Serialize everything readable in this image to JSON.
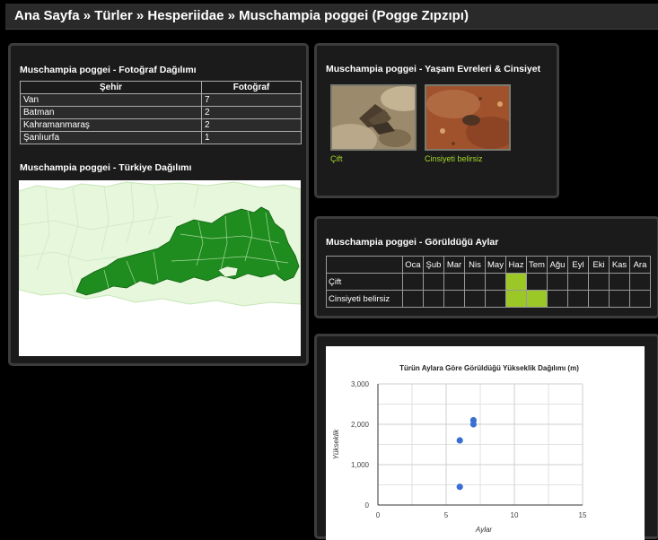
{
  "breadcrumb": "Ana Sayfa » Türler » Hesperiidae » Muschampia poggei (Pogge Zıpzıpı)",
  "photo_panel": {
    "title": "Muschampia poggei - Fotoğraf Dağılımı",
    "headers": [
      "Şehir",
      "Fotoğraf"
    ],
    "rows": [
      {
        "city": "Van",
        "count": "7"
      },
      {
        "city": "Batman",
        "count": "2"
      },
      {
        "city": "Kahramanmaraş",
        "count": "2"
      },
      {
        "city": "Şanlıurfa",
        "count": "1"
      }
    ],
    "map_title": "Muschampia poggei - Türkiye Dağılımı"
  },
  "life_panel": {
    "title": "Muschampia poggei - Yaşam Evreleri & Cinsiyet",
    "items": [
      {
        "label": "Çift"
      },
      {
        "label": "Cinsiyeti belirsiz"
      }
    ]
  },
  "months_panel": {
    "title": "Muschampia poggei - Görüldüğü Aylar",
    "months": [
      "Oca",
      "Şub",
      "Mar",
      "Nis",
      "May",
      "Haz",
      "Tem",
      "Ağu",
      "Eyl",
      "Eki",
      "Kas",
      "Ara"
    ],
    "rows": [
      {
        "label": "Çift",
        "active": [
          false,
          false,
          false,
          false,
          false,
          true,
          false,
          false,
          false,
          false,
          false,
          false
        ]
      },
      {
        "label": "Cinsiyeti belirsiz",
        "active": [
          false,
          false,
          false,
          false,
          false,
          true,
          true,
          false,
          false,
          false,
          false,
          false
        ]
      }
    ],
    "active_color": "#9bc827"
  },
  "chart_data": {
    "type": "scatter",
    "title": "Türün Aylara Göre Görüldüğü Yükseklik Dağılımı (m)",
    "xlabel": "Aylar",
    "ylabel": "Yükseklik",
    "xlim": [
      0,
      15
    ],
    "ylim": [
      0,
      3000
    ],
    "xticks": [
      "0",
      "5",
      "10",
      "15"
    ],
    "yticks": [
      "0",
      "1,000",
      "2,000",
      "3,000"
    ],
    "grid": true,
    "series": [
      {
        "x": [
          6,
          6,
          7,
          7
        ],
        "y": [
          450,
          1600,
          2000,
          2100
        ],
        "color": "#3a6fd1"
      }
    ]
  }
}
